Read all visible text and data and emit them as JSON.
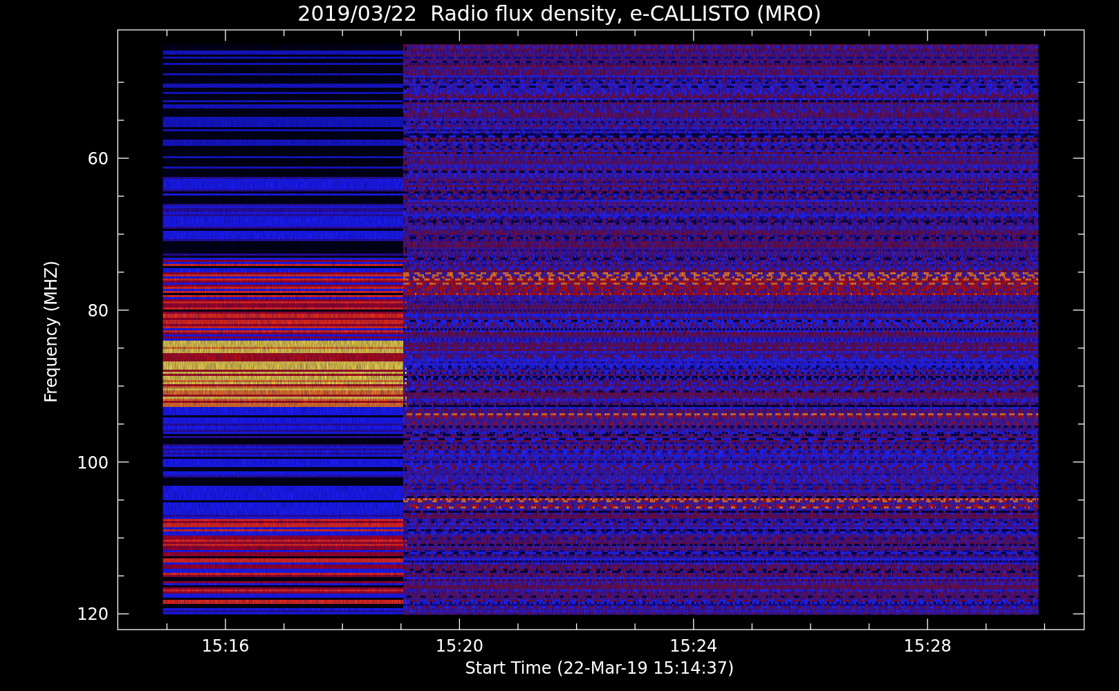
{
  "title": "2019/03/22  Radio flux density, e-CALLISTO (MRO)",
  "plot": {
    "ylabel": "Frequency (MHZ)",
    "xlabel": "Start Time (22-Mar-19 15:14:37)",
    "yticks": [
      {
        "label": "60"
      },
      {
        "label": "80"
      },
      {
        "label": "100"
      },
      {
        "label": "120"
      }
    ],
    "xticks": [
      {
        "label": "15:16"
      },
      {
        "label": "15:20"
      },
      {
        "label": "15:24"
      },
      {
        "label": "15:28"
      }
    ]
  }
}
